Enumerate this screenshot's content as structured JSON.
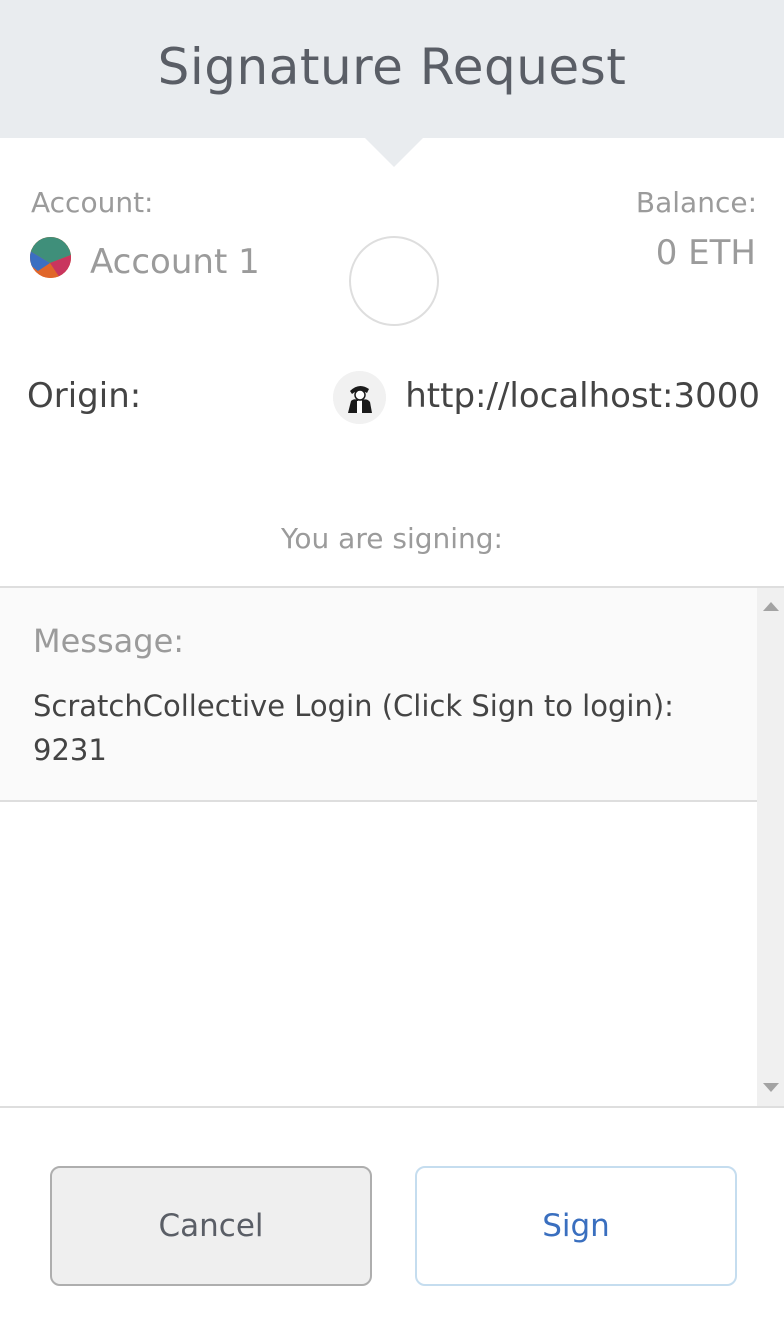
{
  "header": {
    "title": "Signature Request"
  },
  "account": {
    "label": "Account:",
    "name": "Account 1",
    "avatar_icon": "account-identicon"
  },
  "balance": {
    "label": "Balance:",
    "value": "0 ETH"
  },
  "origin": {
    "label": "Origin:",
    "url": "http://localhost:3000",
    "site_icon": "site-favicon"
  },
  "signing": {
    "label": "You are signing:"
  },
  "message": {
    "label": "Message:",
    "text": "ScratchCollective Login (Click Sign to login): 9231"
  },
  "buttons": {
    "cancel_label": "Cancel",
    "sign_label": "Sign"
  },
  "colors": {
    "header_bg": "#e9ecef",
    "sign_text": "#3a6fbf",
    "sign_border": "#c5ddef"
  }
}
